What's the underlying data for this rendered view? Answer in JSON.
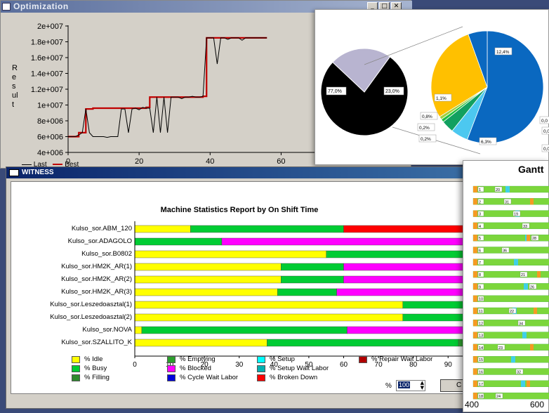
{
  "optimization": {
    "title": "Optimization",
    "ylabel": "Result",
    "legend_last": "Last",
    "legend_best": "Best",
    "y_ticks": [
      "2e+007",
      "1.8e+007",
      "1.6e+007",
      "1.4e+007",
      "1.2e+007",
      "1e+007",
      "8e+006",
      "6e+006",
      "4e+006"
    ],
    "x_ticks": [
      "0",
      "20",
      "40",
      "60"
    ]
  },
  "pie_chart": {
    "labels_left": [
      "77,0%",
      "23,0%"
    ],
    "labels_right": [
      "12,4%",
      "1,1%",
      "0,8%",
      "0,2%",
      "0,2%",
      "6,3%",
      "0,0",
      "0,0",
      "0,0"
    ]
  },
  "witness": {
    "title": "WITNESS",
    "chart_title": "Machine Statistics   Report by On Shift Time",
    "zoom_label": "%",
    "zoom_value": "100",
    "close_button": "C"
  },
  "gantt": {
    "title": "Gantt",
    "rows": [
      "1",
      "2",
      "3",
      "4",
      "5",
      "6",
      "7",
      "8",
      "9",
      "10",
      "11",
      "12",
      "13",
      "14",
      "15",
      "16",
      "17",
      "18"
    ],
    "labels": [
      "20",
      "31",
      "19",
      "33",
      "28",
      "36",
      "21",
      "26",
      "22",
      "34",
      "23",
      "32",
      "24",
      "30",
      "29"
    ],
    "x_ticks": [
      "400",
      "600"
    ]
  },
  "chart_data": [
    {
      "type": "line",
      "title": "",
      "xlabel": "",
      "ylabel": "Result",
      "xlim": [
        0,
        70
      ],
      "ylim": [
        4000000,
        20000000
      ],
      "series": [
        {
          "name": "Best",
          "x": [
            0,
            2,
            3,
            4,
            5,
            6,
            7,
            15,
            16,
            22,
            23,
            30,
            31,
            38,
            39,
            40,
            41,
            42,
            43,
            44,
            45,
            46,
            47,
            48,
            49,
            50,
            51,
            52,
            53,
            54,
            55,
            56
          ],
          "y": [
            6000000,
            6000000,
            6500000,
            6500000,
            9500000,
            9500000,
            9600000,
            9600000,
            9600000,
            9700000,
            11000000,
            11000000,
            11000000,
            11100000,
            18500000,
            18500000,
            18500000,
            18500000,
            18500000,
            18500000,
            18500000,
            18500000,
            18500000,
            18500000,
            18500000,
            18500000,
            18500000,
            18500000,
            18500000,
            18500000,
            18500000,
            18500000
          ]
        },
        {
          "name": "Last",
          "x": [
            0,
            2,
            3,
            4,
            5,
            6,
            7,
            8,
            9,
            10,
            11,
            12,
            13,
            14,
            15,
            16,
            17,
            18,
            19,
            20,
            21,
            22,
            23,
            24,
            25,
            26,
            27,
            28,
            29,
            30,
            31,
            32,
            33,
            34,
            35,
            36,
            37,
            38,
            39,
            40,
            41,
            42,
            43,
            44,
            45,
            46,
            47,
            48,
            49,
            50,
            51,
            52,
            53,
            54,
            55,
            56
          ],
          "y": [
            6000000,
            6000000,
            6200000,
            6500000,
            9500000,
            6500000,
            6000000,
            6000000,
            6000000,
            6000000,
            5900000,
            6000000,
            6000000,
            6000000,
            9500000,
            9500000,
            6500000,
            9500000,
            9600000,
            9400000,
            9700000,
            9600000,
            9600000,
            6500000,
            11000000,
            6500000,
            11000000,
            6500000,
            11000000,
            11000000,
            11000000,
            10800000,
            11000000,
            11000000,
            11100000,
            11000000,
            11000000,
            11100000,
            18500000,
            18500000,
            18500000,
            15200000,
            18500000,
            18500000,
            18300000,
            18500000,
            18500000,
            18500000,
            18200000,
            18500000,
            18500000,
            18500000,
            18500000,
            18500000,
            18500000,
            18500000
          ]
        }
      ]
    },
    {
      "type": "bar",
      "stacked": true,
      "orientation": "horizontal",
      "title": "Machine Statistics   Report by On Shift Time",
      "xlim": [
        0,
        100
      ],
      "x_ticks": [
        "0",
        "10",
        "20",
        "30",
        "40",
        "50",
        "60",
        "70",
        "80",
        "90"
      ],
      "categories": [
        "Kulso_sor.ABM_120",
        "Kulso_sor.ADAGOLO",
        "Kulso_sor.B0802",
        "Kulso_sor.HM2K_AR(1)",
        "Kulso_sor.HM2K_AR(2)",
        "Kulso_sor.HM2K_AR(3)",
        "Kulso_sor.Leszedoasztal(1)",
        "Kulso_sor.Leszedoasztal(2)",
        "Kulso_sor.NOVA",
        "Kulso_sor.SZALLITO_K"
      ],
      "series": [
        {
          "name": "% Idle",
          "color": "#ffff00",
          "values": [
            16,
            0,
            55,
            42,
            42,
            41,
            77,
            77,
            2,
            38
          ]
        },
        {
          "name": "% Busy",
          "color": "#00cc33",
          "values": [
            44,
            25,
            45,
            18,
            18,
            17,
            23,
            23,
            59,
            55
          ]
        },
        {
          "name": "% Blocked",
          "color": "#ff00ff",
          "values": [
            0,
            75,
            0,
            40,
            40,
            39,
            0,
            0,
            39,
            0
          ]
        },
        {
          "name": "% Broken Down",
          "color": "#ff0000",
          "values": [
            40,
            0,
            0,
            0,
            0,
            3,
            0,
            0,
            0,
            0
          ]
        },
        {
          "name": "% Emptying",
          "color": "#33aa33",
          "values": [
            0,
            0,
            0,
            0,
            0,
            0,
            0,
            0,
            0,
            7
          ]
        }
      ],
      "legend": [
        {
          "name": "% Idle",
          "color": "#ffff00"
        },
        {
          "name": "% Emptying",
          "color": "#2ca02c"
        },
        {
          "name": "% Setup",
          "color": "#00ffff"
        },
        {
          "name": "% Repair Wait Labor",
          "color": "#b00000"
        },
        {
          "name": "% Busy",
          "color": "#00cc33"
        },
        {
          "name": "% Blocked",
          "color": "#ff00ff"
        },
        {
          "name": "% Setup Wait Labor",
          "color": "#00b0b0"
        },
        {
          "name": "% Filling",
          "color": "#2e8b2e"
        },
        {
          "name": "% Cycle Wait Labor",
          "color": "#0000dd"
        },
        {
          "name": "% Broken Down",
          "color": "#ff0000"
        }
      ]
    },
    {
      "type": "pie",
      "values": [
        77.0,
        23.0
      ],
      "labels": [
        "77,0%",
        "23,0%"
      ],
      "colors": [
        "#000000",
        "#b8b4d0"
      ]
    },
    {
      "type": "pie",
      "values": [
        12.4,
        1.1,
        0.8,
        0.2,
        0.2,
        6.3
      ],
      "labels": [
        "12,4%",
        "1,1%",
        "0,8%",
        "0,2%",
        "0,2%",
        "6,3%"
      ],
      "colors": [
        "#0a68c0",
        "#4cc8f0",
        "#12a060",
        "#20c040",
        "#a0d040",
        "#ffc000"
      ]
    }
  ]
}
